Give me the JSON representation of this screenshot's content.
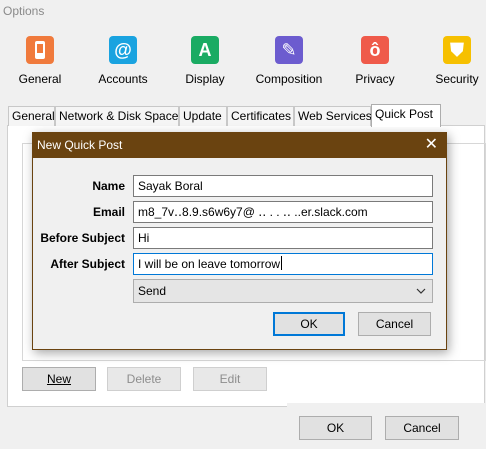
{
  "window": {
    "title": "Options"
  },
  "categories": [
    {
      "label": "General",
      "icon": "general-icon",
      "glyph": "▮",
      "color": "#f07a3c"
    },
    {
      "label": "Accounts",
      "icon": "at-sign-icon",
      "glyph": "@",
      "color": "#1aa3e0"
    },
    {
      "label": "Display",
      "icon": "display-letter-a-icon",
      "glyph": "A",
      "color": "#1aab63"
    },
    {
      "label": "Composition",
      "icon": "pencil-icon",
      "glyph": "✎",
      "color": "#6c5ccf"
    },
    {
      "label": "Privacy",
      "icon": "privacy-icon",
      "glyph": "ô",
      "color": "#ef5a4a"
    },
    {
      "label": "Security",
      "icon": "shield-icon",
      "glyph": "⛊",
      "color": "#f6c000"
    }
  ],
  "tabs": [
    {
      "label": "General"
    },
    {
      "label": "Network & Disk Space"
    },
    {
      "label": "Update"
    },
    {
      "label": "Certificates"
    },
    {
      "label": "Web Services"
    },
    {
      "label": "Quick Post"
    }
  ],
  "panel": {
    "new_label": "New",
    "delete_label": "Delete",
    "edit_label": "Edit"
  },
  "footer": {
    "ok_label": "OK",
    "cancel_label": "Cancel"
  },
  "dialog": {
    "title": "New Quick Post",
    "close_glyph": "✕",
    "fields": {
      "name_label": "Name",
      "name_value": "Sayak Boral",
      "email_label": "Email",
      "email_value": "m8_7v‥8.9.s6w6y7@  ‥ .  . ‥  ..er.slack.com",
      "before_label": "Before Subject",
      "before_value": "Hi",
      "after_label": "After Subject",
      "after_value": "I will be on leave tomorrow"
    },
    "action_selected": "Send",
    "ok_label": "OK",
    "cancel_label": "Cancel"
  }
}
